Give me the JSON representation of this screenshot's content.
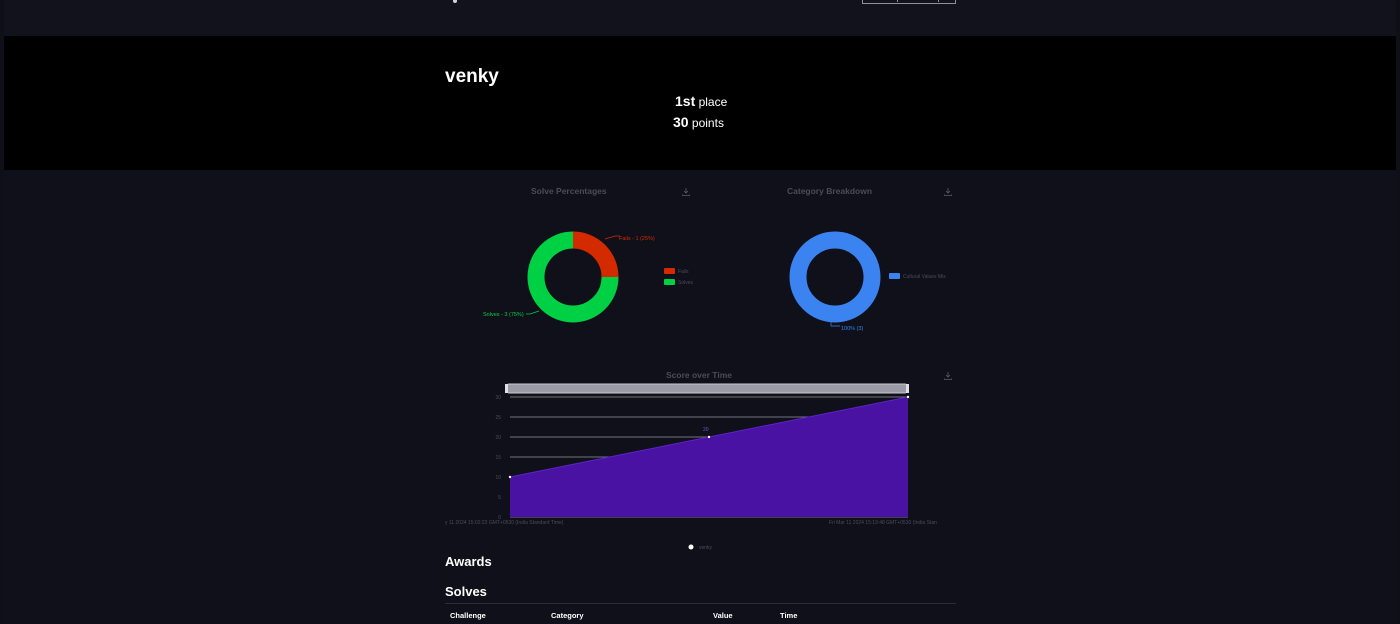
{
  "team": {
    "name": "venky",
    "place": "1st",
    "place_suffix": "place",
    "points": "30",
    "points_suffix": "points"
  },
  "colors": {
    "fails": "#d42a00",
    "solves": "#00d144",
    "category": "#3a83f0",
    "score_area": "#4a12a2"
  },
  "solve_chart": {
    "title": "Solve Percentages",
    "fails_label": "Fails - 1 (25%)",
    "solves_label": "Solves - 3 (75%)",
    "legend_fails": "Fails",
    "legend_solves": "Solves"
  },
  "category_chart": {
    "title": "Category Breakdown",
    "legend": "Cultural Values Mix",
    "slice_label": "100% (3)"
  },
  "score_chart": {
    "title": "Score over Time",
    "x_start_label": "y 11 2024 15:02:23 GMT+0530 (India Standard Time)",
    "x_end_label": "Fri Mar 11 2024 15:19:48 GMT+0530 (India Stan",
    "point_label": "20",
    "legend": "venky",
    "y_ticks": [
      "30",
      "25",
      "20",
      "15",
      "10",
      "5",
      "0"
    ]
  },
  "chart_data": [
    {
      "type": "pie",
      "title": "Solve Percentages",
      "categories": [
        "Fails",
        "Solves"
      ],
      "values": [
        1,
        3
      ]
    },
    {
      "type": "pie",
      "title": "Category Breakdown",
      "categories": [
        "Cultural Values Mix"
      ],
      "values": [
        3
      ]
    },
    {
      "type": "area",
      "title": "Score over Time",
      "series": [
        {
          "name": "venky",
          "x": [
            0,
            1,
            2
          ],
          "values": [
            10,
            20,
            30
          ]
        }
      ],
      "ylim": [
        0,
        30
      ]
    }
  ],
  "sections": {
    "awards": "Awards",
    "solves": "Solves"
  },
  "table": {
    "headers": [
      "Challenge",
      "Category",
      "Value",
      "Time"
    ]
  }
}
